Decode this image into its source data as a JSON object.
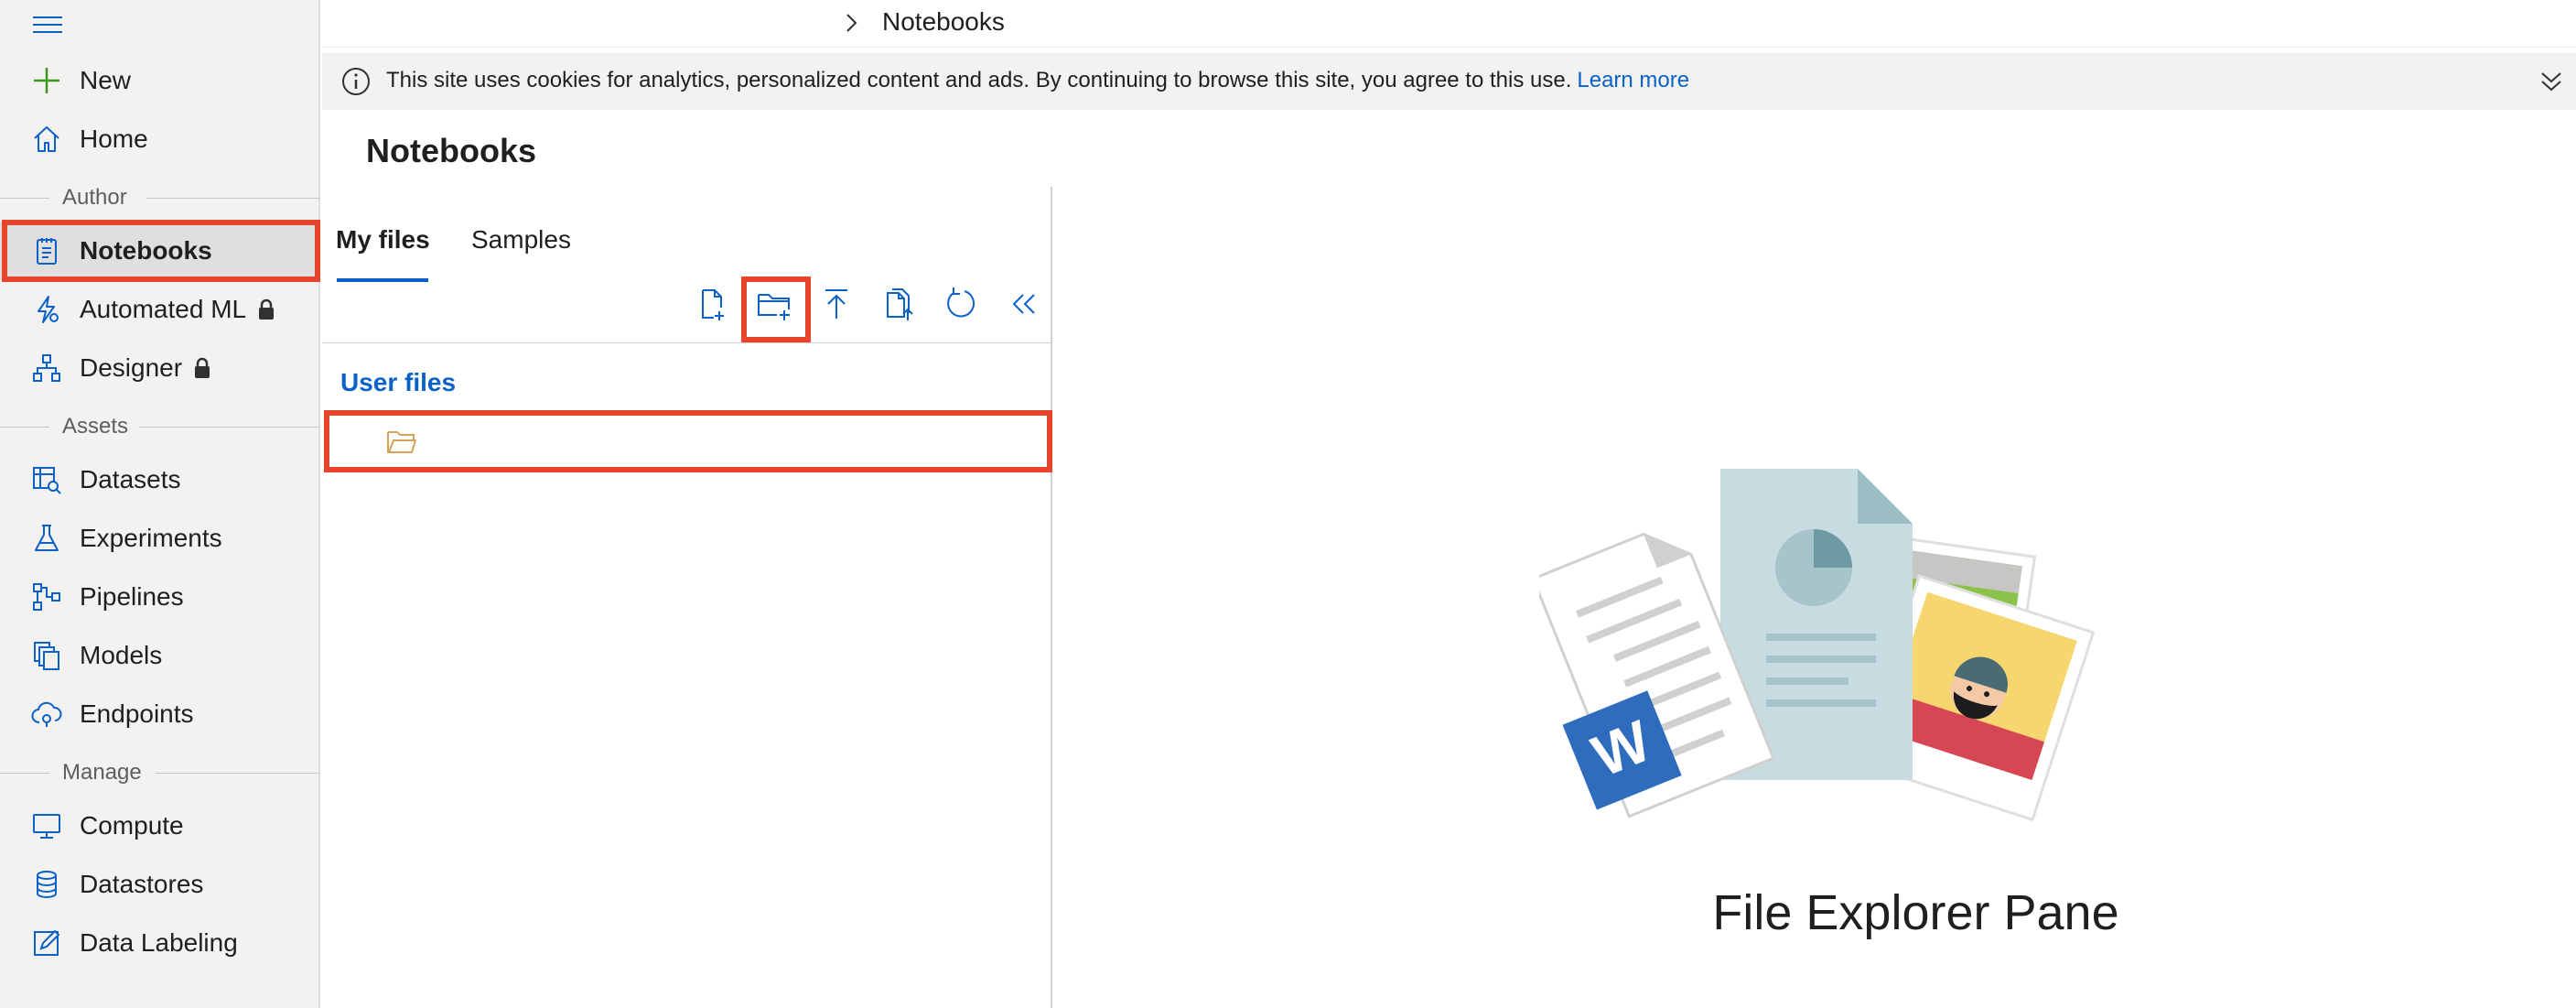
{
  "nav": {
    "new_label": "New",
    "home_label": "Home",
    "author_section": "Author",
    "notebooks_label": "Notebooks",
    "automated_ml_label": "Automated ML",
    "designer_label": "Designer",
    "assets_section": "Assets",
    "datasets_label": "Datasets",
    "experiments_label": "Experiments",
    "pipelines_label": "Pipelines",
    "models_label": "Models",
    "endpoints_label": "Endpoints",
    "manage_section": "Manage",
    "compute_label": "Compute",
    "datastores_label": "Datastores",
    "data_labeling_label": "Data Labeling"
  },
  "breadcrumb": {
    "current": "Notebooks"
  },
  "cookie_bar": {
    "message": "This site uses cookies for analytics, personalized content and ads. By continuing to browse this site, you agree to this use.",
    "link": "Learn more"
  },
  "page": {
    "title": "Notebooks"
  },
  "file_pane": {
    "tabs": [
      {
        "label": "My files"
      },
      {
        "label": "Samples"
      }
    ],
    "toolbar": [
      {
        "icon": "new-file-icon"
      },
      {
        "icon": "new-folder-icon"
      },
      {
        "icon": "upload-icon"
      },
      {
        "icon": "upload-folder-icon"
      },
      {
        "icon": "refresh-icon"
      },
      {
        "icon": "collapse-icon"
      }
    ],
    "section_label": "User files"
  },
  "explorer": {
    "label": "File Explorer Pane"
  },
  "colors": {
    "accent": "#0a61c9",
    "highlight": "#e8432c",
    "nav_bg": "#f3f2f1",
    "folder": "#d8a25b"
  }
}
